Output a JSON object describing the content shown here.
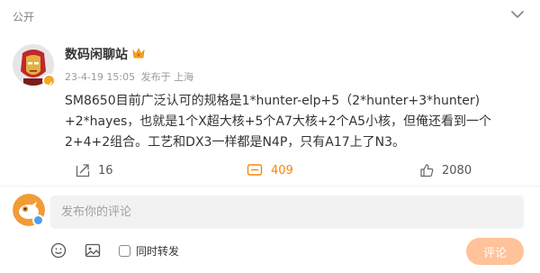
{
  "header": {
    "visibility_label": "公开"
  },
  "post": {
    "username": "数码闲聊站",
    "timestamp": "23-4-19 15:05",
    "source": "发布于 上海",
    "text_lines": [
      "SM8650目前广泛认可的规格是1*hunter-elp+5（2*hunter+3*hunter)",
      "+2*hayes，也就是1个X超大核+5个A7大核+2个A5小核，但俺还看到一个",
      "2+4+2组合。工艺和DX3一样都是N4P，只有A17上了N3。"
    ]
  },
  "actions": {
    "repost_count": "16",
    "comment_count": "409",
    "like_count": "2080"
  },
  "comment": {
    "placeholder": "发布你的评论",
    "repost_option_label": "同时转发",
    "submit_label": "评论"
  },
  "colors": {
    "accent": "#ff8200",
    "submit_disabled": "#ffc299"
  },
  "icons": [
    "chevron-down-icon",
    "crown-icon",
    "verified-badge-icon",
    "repost-icon",
    "comment-icon",
    "like-icon",
    "emoji-icon",
    "image-icon"
  ]
}
